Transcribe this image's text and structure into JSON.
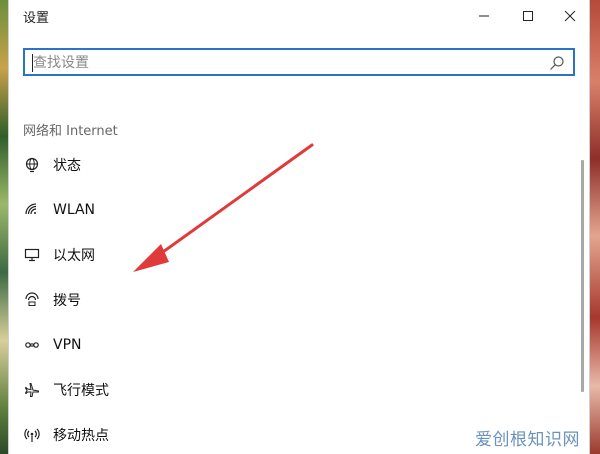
{
  "window": {
    "title": "设置",
    "controls": [
      "minimize",
      "maximize",
      "close"
    ]
  },
  "search": {
    "placeholder": "查找设置",
    "value": ""
  },
  "section": {
    "title": "网络和 Internet"
  },
  "nav": {
    "items": [
      {
        "label": "状态",
        "icon": "globe-status-icon"
      },
      {
        "label": "WLAN",
        "icon": "wifi-icon"
      },
      {
        "label": "以太网",
        "icon": "ethernet-icon"
      },
      {
        "label": "拨号",
        "icon": "dialup-icon"
      },
      {
        "label": "VPN",
        "icon": "vpn-icon"
      },
      {
        "label": "飞行模式",
        "icon": "airplane-icon"
      },
      {
        "label": "移动热点",
        "icon": "hotspot-icon"
      }
    ]
  },
  "annotation": {
    "arrow_color": "#e03a3a"
  },
  "watermark": "爱创根知识网"
}
